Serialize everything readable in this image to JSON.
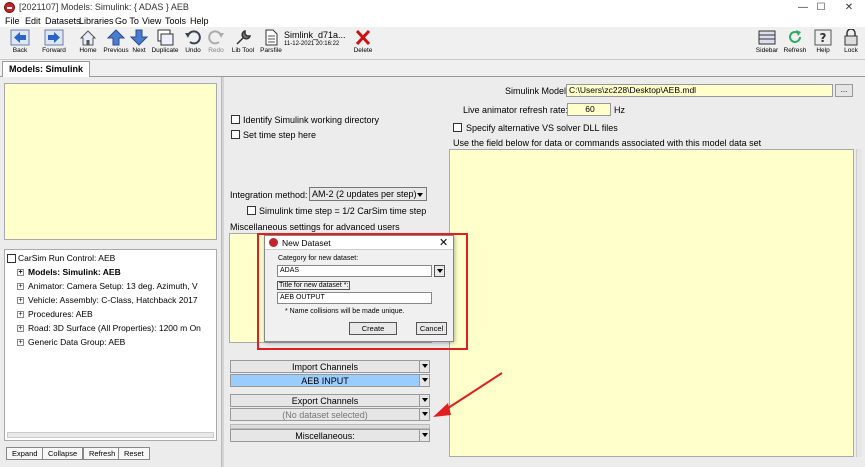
{
  "window": {
    "title": "[2021107] Models: Simulink: { ADAS } AEB",
    "controls": [
      "—",
      "☐",
      "✕"
    ]
  },
  "menu": [
    "File",
    "Edit",
    "Datasets",
    "Libraries",
    "Go To",
    "View",
    "Tools",
    "Help"
  ],
  "toolbar": {
    "back": "Back",
    "forward": "Forward",
    "home": "Home",
    "previous": "Previous",
    "next": "Next",
    "duplicate": "Duplicate",
    "undo": "Undo",
    "redo": "Redo",
    "lib_tool": "Lib Tool",
    "parsfile": "Parsfile",
    "dataset_name": "Simlink_d71a...",
    "dataset_time": "11-12-2021 20:16:22",
    "delete": "Delete",
    "sidebar": "Sidebar",
    "refresh": "Refresh",
    "help": "Help",
    "lock": "Lock"
  },
  "tab": "Models: Simulink",
  "tree": {
    "root": "CarSim Run Control: AEB",
    "items": [
      "Models: Simulink: AEB",
      "Animator: Camera Setup: 13 deg. Azimuth, V",
      "Vehicle: Assembly: C-Class, Hatchback 2017",
      "Procedures: AEB",
      "Road: 3D Surface (All Properties): 1200 m On",
      "Generic Data Group: AEB"
    ]
  },
  "left_buttons": [
    "Expand",
    "Collapse",
    "Refresh",
    "Reset"
  ],
  "center": {
    "identify_label": "Identify Simulink working directory",
    "set_time_label": "Set time step here",
    "integration_label": "Integration method:",
    "integration_value": "AM-2 (2 updates per step)",
    "sim_time_label": "Simulink time step = 1/2 CarSim time step",
    "misc_label": "Miscellaneous settings for advanced users",
    "import_channels": "Import Channels",
    "aeb_input": "AEB INPUT",
    "export_channels": "Export Channels",
    "no_dataset": "(No dataset selected)",
    "miscellaneous": "Miscellaneous:"
  },
  "right": {
    "model_label": "Simulink Model:",
    "model_path": "C:\\Users\\zc228\\Desktop\\AEB.mdl",
    "browse": "...",
    "refresh_label": "Live animator refresh rate:",
    "refresh_value": "60",
    "refresh_unit": "Hz",
    "vs_solver_label": "Specify alternative VS solver DLL files",
    "field_hint": "Use the field below  for data or commands associated with this model data set"
  },
  "dialog": {
    "title": "New Dataset",
    "category_label": "Category for new dataset:",
    "category_value": "ADAS",
    "title_label": "Title for new dataset *:",
    "title_value": "AEB OUTPUT",
    "note": "* Name collisions will be made unique.",
    "create": "Create",
    "cancel": "Cancel"
  },
  "colors": {
    "yellow_field": "#ffffcc",
    "highlight": "#e02020",
    "selected_blue": "#99ccff",
    "arrow": "#e02020"
  }
}
